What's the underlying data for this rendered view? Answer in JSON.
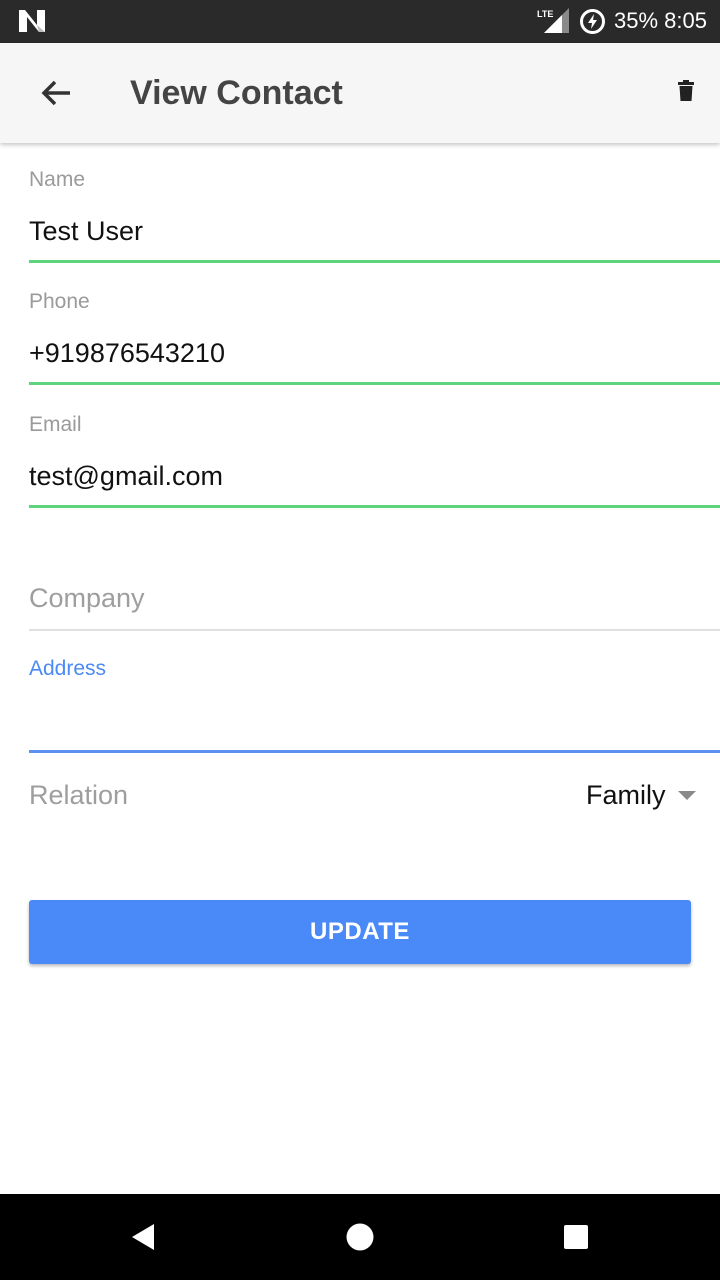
{
  "status_bar": {
    "network": "LTE",
    "battery": "35%",
    "time": "8:05",
    "icons": [
      "n-logo-icon",
      "lte-signal-icon",
      "battery-charging-icon"
    ]
  },
  "app_bar": {
    "title": "View Contact",
    "back_icon": "arrow-left-icon",
    "delete_icon": "trash-icon"
  },
  "form": {
    "name": {
      "label": "Name",
      "value": "Test User"
    },
    "phone": {
      "label": "Phone",
      "value": "+919876543210"
    },
    "email": {
      "label": "Email",
      "value": "test@gmail.com"
    },
    "company": {
      "placeholder": "Company",
      "value": ""
    },
    "address": {
      "label": "Address",
      "value": ""
    },
    "relation": {
      "label": "Relation",
      "selected": "Family"
    }
  },
  "update_button": {
    "label": "UPDATE"
  },
  "nav_bar": {
    "icons": [
      "nav-back-icon",
      "nav-home-icon",
      "nav-recents-icon"
    ]
  },
  "colors": {
    "accent_blue": "#4a8af8",
    "valid_green": "#5dd47b",
    "status_bar_bg": "#2a2a2a",
    "app_bar_bg": "#f6f6f6"
  }
}
